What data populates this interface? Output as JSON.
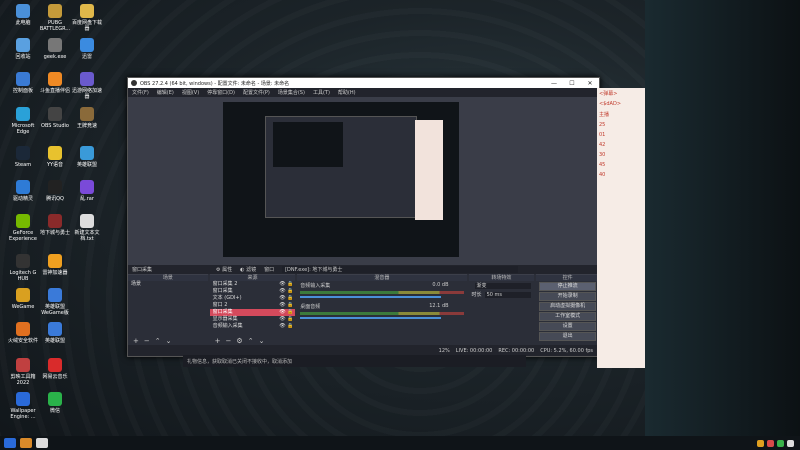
{
  "desktop": {
    "icons": [
      {
        "label": "此电脑",
        "icon": "computer-icon",
        "color": "#4a90d9"
      },
      {
        "label": "PUBG BATTLEGR...",
        "icon": "pubg-icon",
        "color": "#c49a3a"
      },
      {
        "label": "百度网盘下载器",
        "icon": "folder-icon",
        "color": "#e0b84a"
      },
      {
        "label": "回收站",
        "icon": "recycle-bin-icon",
        "color": "#5aa0e0"
      },
      {
        "label": "geek.exe",
        "icon": "geek-icon",
        "color": "#777"
      },
      {
        "label": "迅雷",
        "icon": "xunlei-icon",
        "color": "#3b8be0"
      },
      {
        "label": "控制面板",
        "icon": "control-panel-icon",
        "color": "#3a7bd5"
      },
      {
        "label": "斗鱼直播伴侣",
        "icon": "douyu-icon",
        "color": "#f08a24"
      },
      {
        "label": "迅游网络加速器",
        "icon": "xunyou-icon",
        "color": "#6a5acd"
      },
      {
        "label": "Microsoft Edge",
        "icon": "edge-icon",
        "color": "#2aa1d8"
      },
      {
        "label": "OBS Studio",
        "icon": "obs-icon",
        "color": "#444"
      },
      {
        "label": "王牌竞速",
        "icon": "racing-icon",
        "color": "#8a6a3a"
      },
      {
        "label": "Steam",
        "icon": "steam-icon",
        "color": "#1b2838"
      },
      {
        "label": "YY语音",
        "icon": "yy-icon",
        "color": "#e8c22e"
      },
      {
        "label": "英雄联盟",
        "icon": "lol-icon",
        "color": "#3a9ad9"
      },
      {
        "label": "驱动精灵",
        "icon": "driver-icon",
        "color": "#2e7bd6"
      },
      {
        "label": "腾讯QQ",
        "icon": "qq-icon",
        "color": "#222"
      },
      {
        "label": "乱.rar",
        "icon": "rar-icon",
        "color": "#7a4ad9"
      },
      {
        "label": "GeForce Experience",
        "icon": "geforce-icon",
        "color": "#76b900"
      },
      {
        "label": "地下城与勇士",
        "icon": "dnf-icon",
        "color": "#8a2a2a"
      },
      {
        "label": "新建文本文档.txt",
        "icon": "txt-icon",
        "color": "#ddd"
      },
      {
        "label": "Logitech G HUB",
        "icon": "logitech-icon",
        "color": "#333"
      },
      {
        "label": "雷神加速器",
        "icon": "leishen-icon",
        "color": "#f0a020"
      },
      {
        "label": "WeGame",
        "icon": "wegame-icon",
        "color": "#d9a020"
      },
      {
        "label": "英雄联盟WeGame版",
        "icon": "lol-wegame-icon",
        "color": "#3a7ad9"
      },
      {
        "label": "火绒安全软件",
        "icon": "huorong-icon",
        "color": "#e07020"
      },
      {
        "label": "英雄联盟",
        "icon": "lol-icon-2",
        "color": "#3a7ad9"
      },
      {
        "label": "剪映工具箱 2022",
        "icon": "jianying-icon",
        "color": "#c04040"
      },
      {
        "label": "网易云音乐",
        "icon": "netease-icon",
        "color": "#d92b2b"
      },
      {
        "label": "Wallpaper Engine: ...",
        "icon": "wallpaper-icon",
        "color": "#2a6ad9"
      },
      {
        "label": "微信",
        "icon": "wechat-icon",
        "color": "#2ab24a"
      }
    ]
  },
  "obs": {
    "title": "OBS 27.2.4 (64 bit, windows) - 配置文件: 未命名 - 场景: 未命名",
    "menu": [
      "文件(F)",
      "编辑(E)",
      "视图(V)",
      "停靠窗口(D)",
      "配置文件(P)",
      "场景集合(S)",
      "工具(T)",
      "帮助(H)"
    ],
    "window_controls": [
      "—",
      "☐",
      "✕"
    ],
    "source_toolbar": {
      "source_name": "窗口采集",
      "properties": "属性",
      "filters": "滤镜",
      "window_label": "窗口",
      "window_value": "[DNF.exe]: 地下城与勇士"
    },
    "docks": {
      "scenes_header": "场景",
      "scenes": [
        "场景"
      ],
      "sources_header": "来源",
      "sources": [
        {
          "name": "窗口采集 2",
          "selected": false
        },
        {
          "name": "窗口采集",
          "selected": false
        },
        {
          "name": "文本 (GDI+)",
          "selected": false
        },
        {
          "name": "窗口 2",
          "selected": false
        },
        {
          "name": "窗口采集",
          "selected": true
        },
        {
          "name": "显示器采集",
          "selected": false
        },
        {
          "name": "音频输入采集",
          "selected": false
        }
      ],
      "mixer_header": "混音器",
      "mixer": [
        {
          "name": "音频输入采集",
          "db": "0.0 dB"
        },
        {
          "name": "桌面音频",
          "db": "12.1 dB"
        }
      ],
      "transitions_header": "转场特效",
      "transition_type": "渐变",
      "duration_label": "时长",
      "duration_value": "50 ms",
      "controls_header": "控件",
      "controls": [
        "停止推流",
        "开始录制",
        "启动虚拟摄像机",
        "工作室模式",
        "设置",
        "退出"
      ]
    },
    "status": {
      "live": "LIVE: 00:00:00",
      "rec": "REC: 00:00:00",
      "cpu": "CPU: 5.2%, 60.00 fps",
      "dropped": "12%"
    }
  },
  "notification": "礼物信息，获取取消已关闭不接收中，取消添加",
  "chat": {
    "lines": [
      "<弹幕>",
      "<$dAD>",
      "主播",
      "25",
      "01",
      "42",
      "30",
      "45",
      "40"
    ]
  },
  "colors": {
    "accent": "#d44a5c",
    "obs_bg": "#2b2e38",
    "mixer_blue": "#4a90d9"
  }
}
